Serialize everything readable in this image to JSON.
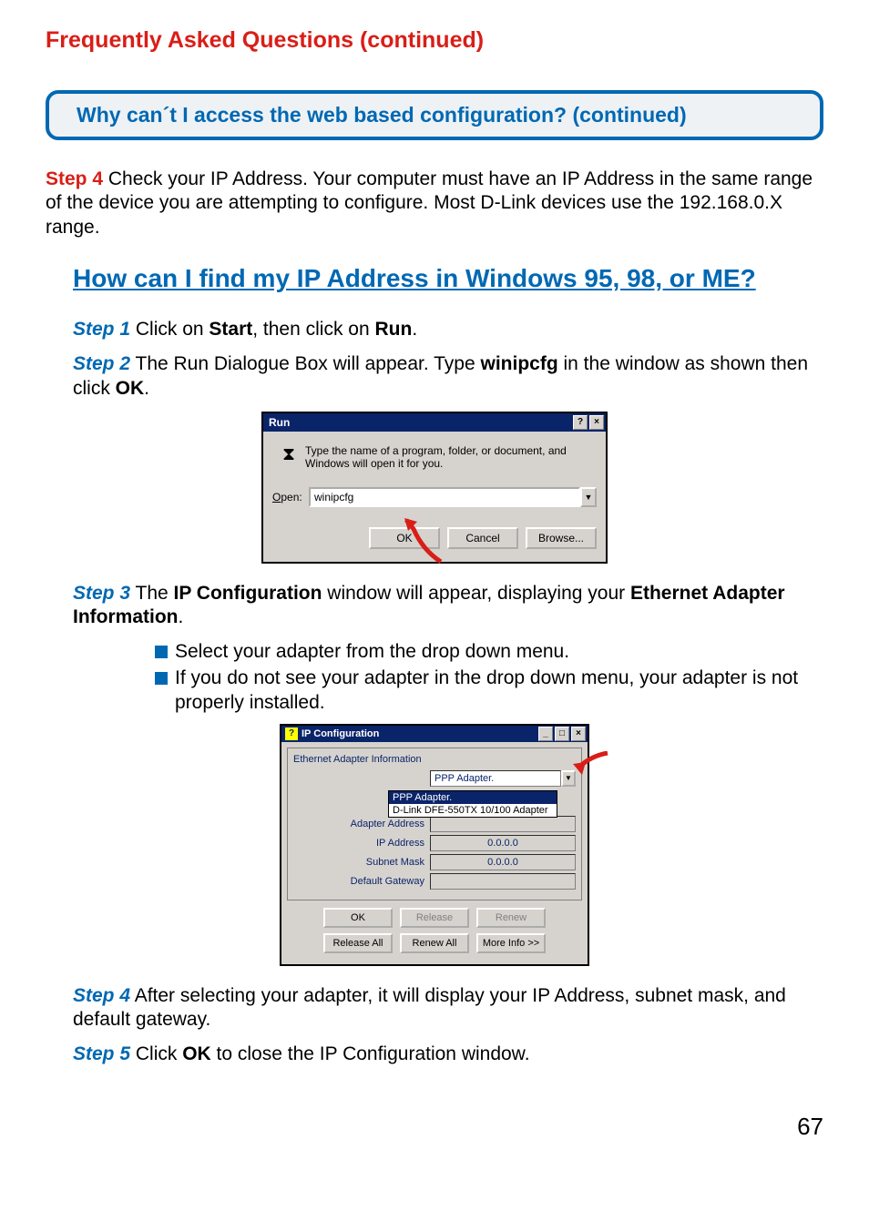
{
  "page_title": "Frequently Asked Questions (continued)",
  "callout": "Why can´t I access the web based configuration? (continued)",
  "step4_label": "Step 4",
  "step4_text": " Check your IP Address. Your computer must have an IP Address in the same range of the device you are attempting to configure. Most D-Link devices use the 192.168.0.X range.",
  "subheading": "How can I find my IP Address in Windows 95, 98, or ME?",
  "sub_step1_label": "Step 1",
  "sub_step1_a": " Click on ",
  "sub_step1_b": "Start",
  "sub_step1_c": ", then click on ",
  "sub_step1_d": "Run",
  "sub_step1_e": ".",
  "sub_step2_label": "Step 2",
  "sub_step2_a": " The Run Dialogue Box will appear. Type ",
  "sub_step2_b": "winipcfg",
  "sub_step2_c": " in the window as shown then click ",
  "sub_step2_d": "OK",
  "sub_step2_e": ".",
  "run_dialog": {
    "title": "Run",
    "message": "Type the name of a program, folder, or document, and Windows will open it for you.",
    "open_label": "Open:",
    "open_label_u": "O",
    "open_value": "winipcfg",
    "ok": "OK",
    "cancel": "Cancel",
    "browse": "Browse..."
  },
  "sub_step3_label": "Step 3",
  "sub_step3_a": " The ",
  "sub_step3_b": "IP Configuration",
  "sub_step3_c": " window will appear, displaying your ",
  "sub_step3_d": "Ethernet Adapter Information",
  "sub_step3_e": ".",
  "bullets": [
    "Select your adapter from the drop down menu.",
    "If you do not see your adapter in the drop down menu, your adapter is not properly installed."
  ],
  "ipcfg": {
    "title": "IP Configuration",
    "legend": "Ethernet Adapter Information",
    "selected_adapter": "PPP Adapter.",
    "options": [
      "PPP Adapter.",
      "D-Link DFE-550TX 10/100 Adapter"
    ],
    "labels": {
      "adapter_address": "Adapter Address",
      "ip_address": "IP Address",
      "subnet_mask": "Subnet Mask",
      "default_gateway": "Default Gateway"
    },
    "values": {
      "ip_address": "0.0.0.0",
      "subnet_mask": "0.0.0.0",
      "default_gateway": ""
    },
    "buttons": {
      "ok": "OK",
      "release": "Release",
      "renew": "Renew",
      "release_all": "Release All",
      "renew_all": "Renew All",
      "more_info": "More Info >>"
    }
  },
  "sub_step4_label": "Step 4",
  "sub_step4_text": "   After selecting your adapter, it will display your IP Address, subnet mask, and default gateway.",
  "sub_step5_label": "Step 5",
  "sub_step5_a": "  Click ",
  "sub_step5_b": "OK",
  "sub_step5_c": " to close the IP Configuration window.",
  "page_number": "67"
}
